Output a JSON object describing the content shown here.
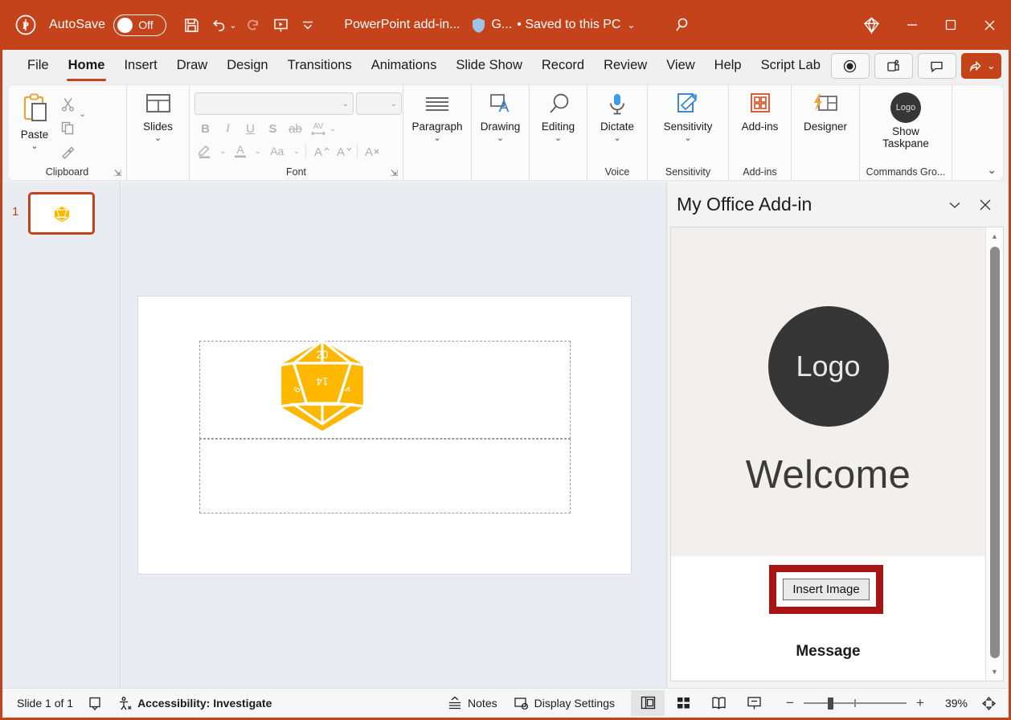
{
  "titlebar": {
    "app_icon": "powerpoint-icon",
    "autosave_label": "AutoSave",
    "autosave_state": "Off",
    "save_icon": "save-icon",
    "undo_icon": "undo-icon",
    "redo_icon": "redo-icon",
    "present_icon": "start-presentation-icon",
    "customize_icon": "customize-quick-access-icon",
    "document_title": "PowerPoint add-in...",
    "sensitivity_icon": "shield-icon",
    "sensitivity_label": "G...",
    "save_state": "• Saved to this PC",
    "search_icon": "search-icon",
    "diamond_icon": "copilot-icon",
    "minimize_icon": "minimize-icon",
    "maximize_icon": "maximize-icon",
    "close_icon": "close-icon",
    "accent_color": "#C4431B"
  },
  "tabs": [
    {
      "label": "File",
      "active": false
    },
    {
      "label": "Home",
      "active": true
    },
    {
      "label": "Insert",
      "active": false
    },
    {
      "label": "Draw",
      "active": false
    },
    {
      "label": "Design",
      "active": false
    },
    {
      "label": "Transitions",
      "active": false
    },
    {
      "label": "Animations",
      "active": false
    },
    {
      "label": "Slide Show",
      "active": false
    },
    {
      "label": "Record",
      "active": false
    },
    {
      "label": "Review",
      "active": false
    },
    {
      "label": "View",
      "active": false
    },
    {
      "label": "Help",
      "active": false
    },
    {
      "label": "Script Lab",
      "active": false
    }
  ],
  "tabs_right": {
    "record_icon": "record-icon",
    "teams_icon": "present-in-teams-icon",
    "comments_icon": "comments-icon",
    "share_icon": "share-icon",
    "share_caret": "chevron-down-icon",
    "person_icon": "person-add-icon"
  },
  "ribbon": {
    "groups": [
      {
        "name": "clipboard",
        "label": "Clipboard",
        "has_launcher": true,
        "paste_label": "Paste",
        "cut_icon": "cut-icon",
        "copy_icon": "copy-icon",
        "format_painter_icon": "format-painter-icon"
      },
      {
        "name": "slides",
        "label": "",
        "slides_label": "Slides"
      },
      {
        "name": "font",
        "label": "Font",
        "has_launcher": true,
        "font_name_value": "",
        "font_size_value": "",
        "buttons": [
          "B",
          "I",
          "U",
          "S",
          "ab",
          "AV",
          "highlight",
          "font-color",
          "Aa",
          "grow",
          "shrink",
          "clear-formatting"
        ]
      },
      {
        "name": "paragraph",
        "label": "",
        "button_label": "Paragraph"
      },
      {
        "name": "drawing",
        "label": "",
        "button_label": "Drawing"
      },
      {
        "name": "editing",
        "label": "",
        "button_label": "Editing"
      },
      {
        "name": "voice",
        "label": "Voice",
        "button_label": "Dictate"
      },
      {
        "name": "sensitivity",
        "label": "Sensitivity",
        "button_label": "Sensitivity"
      },
      {
        "name": "addins",
        "label": "Add-ins",
        "button_label": "Add-ins"
      },
      {
        "name": "designer",
        "label": "",
        "button_label": "Designer"
      },
      {
        "name": "commands",
        "label": "Commands Gro...",
        "button_label": "Show Taskpane",
        "icon_text": "Logo"
      }
    ],
    "collapse_icon": "chevron-up-icon"
  },
  "thumbnails": {
    "slides": [
      {
        "number": "1",
        "selected": true,
        "content_icon": "d20-dice-icon"
      }
    ]
  },
  "slide": {
    "placeholders": [
      "title-placeholder",
      "subtitle-placeholder"
    ],
    "image_name": "d20-dice-image",
    "image_color": "#FFB800"
  },
  "taskpane": {
    "title": "My Office Add-in",
    "collapse_icon": "chevron-down-icon",
    "close_icon": "close-icon",
    "logo_text": "Logo",
    "welcome_text": "Welcome",
    "insert_button_label": "Insert Image",
    "message_label": "Message",
    "highlight_color": "#A81414",
    "scroll_up_icon": "scroll-up-arrow-icon",
    "scroll_down_icon": "scroll-down-arrow-icon"
  },
  "statusbar": {
    "slide_count": "Slide 1 of 1",
    "language_icon": "language-proofing-icon",
    "accessibility_icon": "accessibility-icon",
    "accessibility_text": "Accessibility: Investigate",
    "notes_icon": "notes-icon",
    "notes_label": "Notes",
    "display_settings_icon": "display-settings-icon",
    "display_settings_label": "Display Settings",
    "views": [
      {
        "name": "normal-view",
        "icon": "normal-view-icon",
        "active": true
      },
      {
        "name": "slide-sorter-view",
        "icon": "slide-sorter-icon",
        "active": false
      },
      {
        "name": "reading-view",
        "icon": "reading-view-icon",
        "active": false
      },
      {
        "name": "slide-show-view",
        "icon": "slide-show-icon",
        "active": false
      }
    ],
    "zoom_out_label": "−",
    "zoom_in_label": "+",
    "zoom_level": "39%",
    "fit_slide_icon": "fit-to-window-icon"
  }
}
